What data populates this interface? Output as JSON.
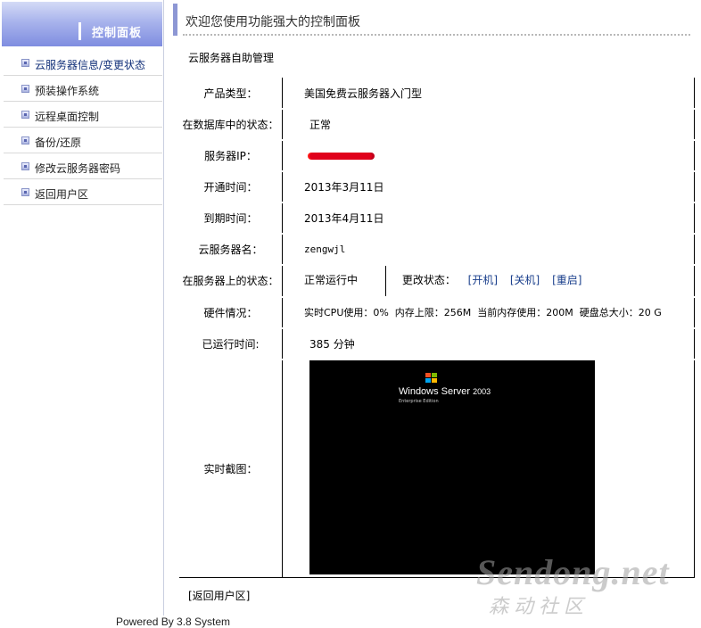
{
  "sidebar": {
    "title": "控制面板",
    "items": [
      {
        "label": "云服务器信息/变更状态"
      },
      {
        "label": "预装操作系统"
      },
      {
        "label": "远程桌面控制"
      },
      {
        "label": "备份/还原"
      },
      {
        "label": "修改云服务器密码"
      },
      {
        "label": "返回用户区"
      }
    ]
  },
  "header": {
    "welcome": "欢迎您使用功能强大的控制面板"
  },
  "section_title": "云服务器自助管理",
  "info": {
    "product_type_label": "产品类型：",
    "product_type_value": "美国免费云服务器入门型",
    "db_status_label": "在数据库中的状态：",
    "db_status_value": "正常",
    "ip_label": "服务器IP：",
    "open_time_label": "开通时间：",
    "open_time_value": "2013年3月11日",
    "expire_time_label": "到期时间：",
    "expire_time_value": "2013年4月11日",
    "server_name_label": "云服务器名：",
    "server_name_value": "zengwjl",
    "server_status_label": "在服务器上的状态：",
    "server_status_value": "正常运行中",
    "change_status_label": "更改状态：",
    "action_start": "[开机]",
    "action_shutdown": "[关机]",
    "action_restart": "[重启]",
    "hardware_label": "硬件情况：",
    "hardware_value": "实时CPU使用：0%  内存上限：256M  当前内存使用：200M  硬盘总大小：20 G",
    "uptime_label": "已运行时间:",
    "uptime_value": "385 分钟",
    "screenshot_label": "实时截图："
  },
  "screen": {
    "brand": "Windows Server",
    "version": "2003",
    "edition": "Enterprise Edition"
  },
  "back_link": "[返回用户区]",
  "footer": "Powered By 3.8 System",
  "watermark": {
    "latin": "Sendong.net",
    "chinese": "森动社区"
  },
  "colors": {
    "sidebar_header": "#8d97d4",
    "link": "#1a3f8c",
    "ip_redaction": "#e0001b"
  }
}
